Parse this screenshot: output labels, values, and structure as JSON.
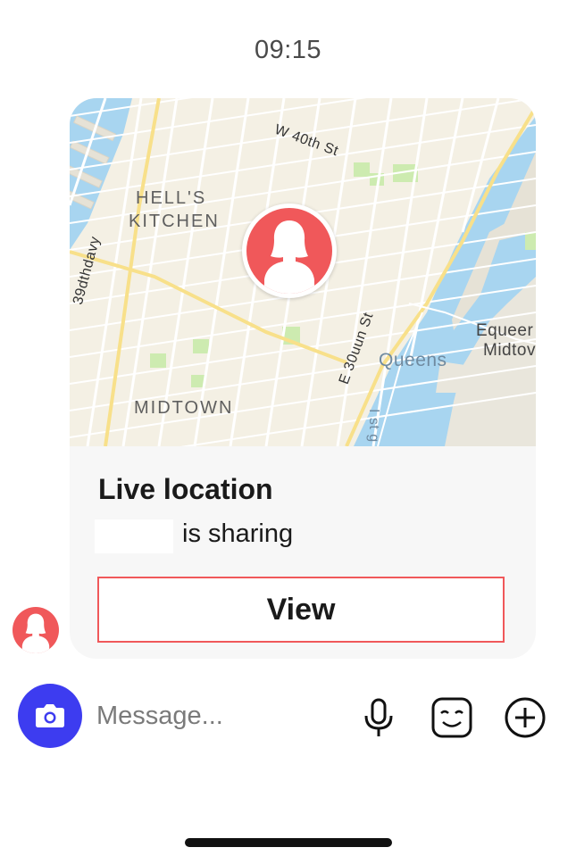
{
  "timestamp": "09:15",
  "map": {
    "labels": {
      "neighborhood_1": "HELL'S",
      "neighborhood_2": "KITCHEN",
      "district": "MIDTOWN",
      "street_north": "W 40th St",
      "street_west": "39dthdavy",
      "street_east": "E 30uun St",
      "borough": "Queens",
      "place_1": "Equeer",
      "place_2": "Midtov",
      "water_river": "I st g"
    },
    "pin_icon": "user-silhouette-icon"
  },
  "card": {
    "title": "Live location",
    "sharing_suffix": "is sharing",
    "view_label": "View"
  },
  "composer": {
    "placeholder": "Message...",
    "icons": [
      "camera-icon",
      "microphone-icon",
      "sticker-face-icon",
      "plus-circle-icon"
    ]
  },
  "colors": {
    "accent_red": "#f0585a",
    "camera_blue": "#3d3cf0",
    "water": "#a8d5f0",
    "land": "#f5f1e6",
    "park": "#cdebb0",
    "highway": "#f8e08a"
  }
}
